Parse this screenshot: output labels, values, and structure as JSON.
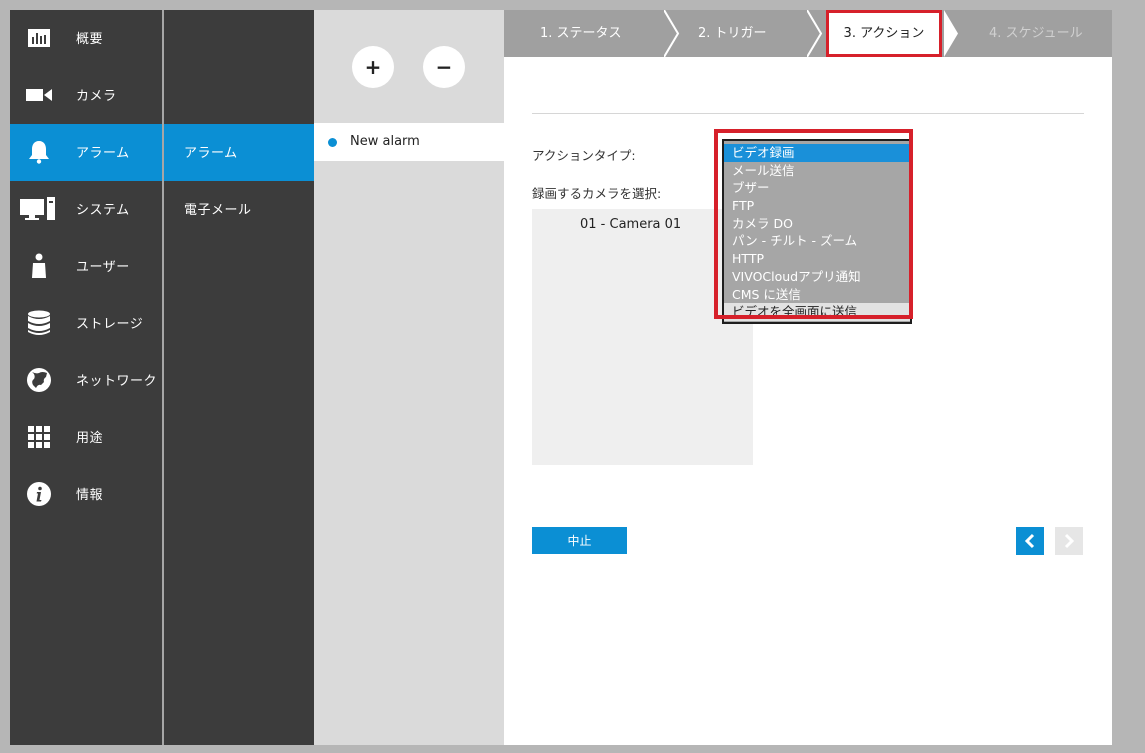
{
  "sidebar": {
    "items": [
      {
        "label": "概要",
        "icon": "chart-icon"
      },
      {
        "label": "カメラ",
        "icon": "camera-icon"
      },
      {
        "label": "アラーム",
        "icon": "bell-icon"
      },
      {
        "label": "システム",
        "icon": "monitor-icon"
      },
      {
        "label": "ユーザー",
        "icon": "user-icon"
      },
      {
        "label": "ストレージ",
        "icon": "database-icon"
      },
      {
        "label": "ネットワーク",
        "icon": "globe-icon"
      },
      {
        "label": "用途",
        "icon": "grid-icon"
      },
      {
        "label": "情報",
        "icon": "info-icon"
      }
    ],
    "active_index": 2
  },
  "subnav": {
    "items": [
      {
        "label": "アラーム"
      },
      {
        "label": "電子メール"
      }
    ],
    "active_index": 0
  },
  "alarm_panel": {
    "add_label": "+",
    "remove_label": "−",
    "alarms": [
      {
        "name": "New alarm"
      }
    ]
  },
  "wizard": {
    "steps": [
      {
        "label": "1. ステータス",
        "state": "done"
      },
      {
        "label": "2. トリガー",
        "state": "done"
      },
      {
        "label": "3. アクション",
        "state": "active"
      },
      {
        "label": "4. スケジュール",
        "state": "disabled"
      }
    ]
  },
  "action_form": {
    "action_type_label": "アクションタイプ:",
    "camera_select_label": "録画するカメラを選択:",
    "cameras": [
      "01 - Camera 01"
    ],
    "action_options": [
      "ビデオ録画",
      "メール送信",
      "ブザー",
      "FTP",
      "カメラ DO",
      "パン - チルト - ズーム",
      "HTTP",
      "VIVOCloudアプリ通知",
      "CMS に送信",
      "ビデオを全画面に送信"
    ],
    "selected_option": "ビデオ録画"
  },
  "footer": {
    "cancel_label": "中止"
  },
  "colors": {
    "accent": "#0b8fd4",
    "sidebar_bg": "#3c3c3c",
    "highlight_red": "#d6202a"
  }
}
